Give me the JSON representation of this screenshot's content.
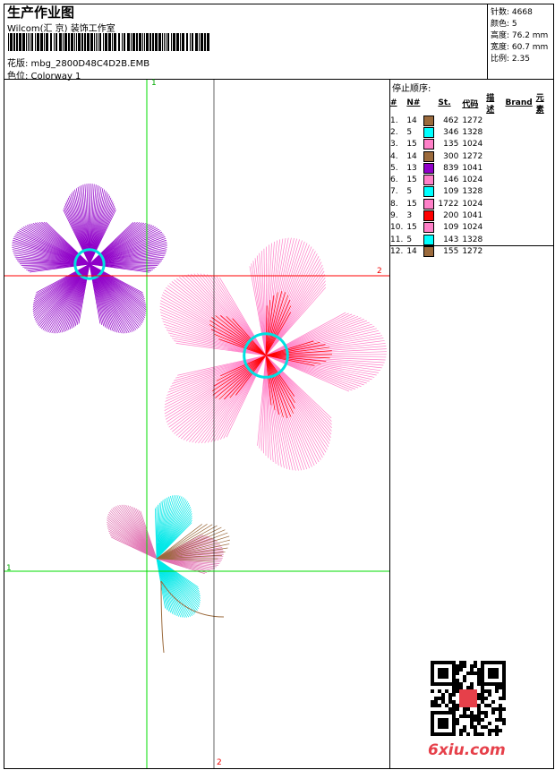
{
  "header": {
    "title": "生产作业图",
    "studio": "Wilcom(汇 京) 装饰工作室",
    "design": "花版: mbg_2800D48C4D2B.EMB",
    "colorway": "色位:  Colorway 1"
  },
  "stats": [
    {
      "label": "针数: 4668"
    },
    {
      "label": "颜色: 5"
    },
    {
      "label": "高度: 76.2 mm"
    },
    {
      "label": "宽度: 60.7 mm"
    },
    {
      "label": "比例: 2.35"
    }
  ],
  "stop_sequence": {
    "title": "停止顺序:",
    "columns": [
      "#",
      "N#",
      "",
      "St.",
      "代码",
      "描述",
      "Brand",
      "元素"
    ],
    "rows": [
      {
        "n": "1.",
        "needle": "14",
        "color": "#9b6a3c",
        "st": "462",
        "code": "1272"
      },
      {
        "n": "2.",
        "needle": "5",
        "color": "#00ffff",
        "st": "346",
        "code": "1328"
      },
      {
        "n": "3.",
        "needle": "15",
        "color": "#ff80c8",
        "st": "135",
        "code": "1024"
      },
      {
        "n": "4.",
        "needle": "14",
        "color": "#9b6a3c",
        "st": "300",
        "code": "1272"
      },
      {
        "n": "5.",
        "needle": "13",
        "color": "#9000c8",
        "st": "839",
        "code": "1041"
      },
      {
        "n": "6.",
        "needle": "15",
        "color": "#ff80c8",
        "st": "146",
        "code": "1024"
      },
      {
        "n": "7.",
        "needle": "5",
        "color": "#00ffff",
        "st": "109",
        "code": "1328"
      },
      {
        "n": "8.",
        "needle": "15",
        "color": "#ff80c8",
        "st": "1722",
        "code": "1024"
      },
      {
        "n": "9.",
        "needle": "3",
        "color": "#ff0000",
        "st": "200",
        "code": "1041"
      },
      {
        "n": "10.",
        "needle": "15",
        "color": "#ff80c8",
        "st": "109",
        "code": "1024"
      },
      {
        "n": "11.",
        "needle": "5",
        "color": "#00ffff",
        "st": "143",
        "code": "1328"
      },
      {
        "n": "12.",
        "needle": "14",
        "color": "#9b6a3c",
        "st": "155",
        "code": "1272"
      }
    ]
  },
  "guides": {
    "v1": "1",
    "h2": "2",
    "h1": "1",
    "v2": "2"
  },
  "watermark": "6xiu.com"
}
